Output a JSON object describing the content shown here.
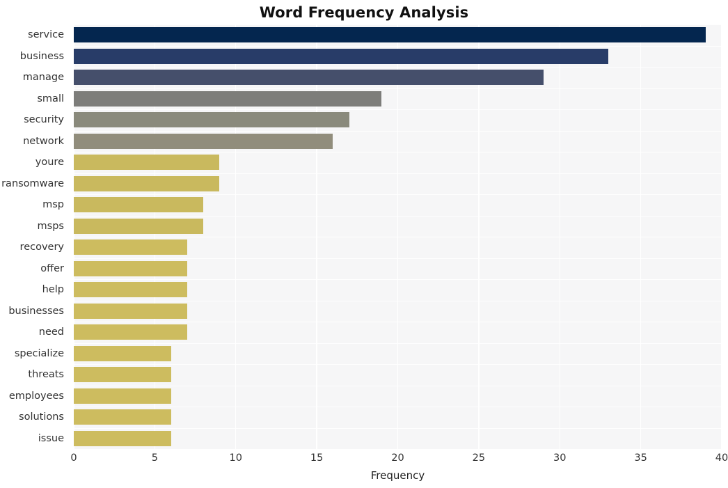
{
  "chart_data": {
    "type": "bar",
    "orientation": "horizontal",
    "title": "Word Frequency Analysis",
    "xlabel": "Frequency",
    "ylabel": "",
    "categories": [
      "service",
      "business",
      "manage",
      "small",
      "security",
      "network",
      "youre",
      "ransomware",
      "msp",
      "msps",
      "recovery",
      "offer",
      "help",
      "businesses",
      "need",
      "specialize",
      "threats",
      "employees",
      "solutions",
      "issue"
    ],
    "values": [
      39,
      33,
      29,
      19,
      17,
      16,
      9,
      9,
      8,
      8,
      7,
      7,
      7,
      7,
      7,
      6,
      6,
      6,
      6,
      6
    ],
    "bar_colors": [
      "#04264f",
      "#283c68",
      "#454f6b",
      "#7d7d7a",
      "#8a8a7c",
      "#918d7c",
      "#c9b95e",
      "#c9b95e",
      "#c9b95e",
      "#c9b95e",
      "#cdbc5f",
      "#cdbc5f",
      "#cdbc5f",
      "#cdbc5f",
      "#cdbc5f",
      "#cdbc5f",
      "#cdbc5f",
      "#cdbc5f",
      "#cdbc5f",
      "#cdbc5f"
    ],
    "xlim": [
      0,
      40
    ],
    "xticks": [
      0,
      5,
      10,
      15,
      20,
      25,
      30,
      35,
      40
    ],
    "xtick_labels": [
      "0",
      "5",
      "10",
      "15",
      "20",
      "25",
      "30",
      "35",
      "40"
    ],
    "grid": true,
    "grid_color": "#ffffff",
    "plot_background": "#f6f6f7",
    "figure_background": "#ffffff",
    "legend": null,
    "legend_position": "none"
  }
}
